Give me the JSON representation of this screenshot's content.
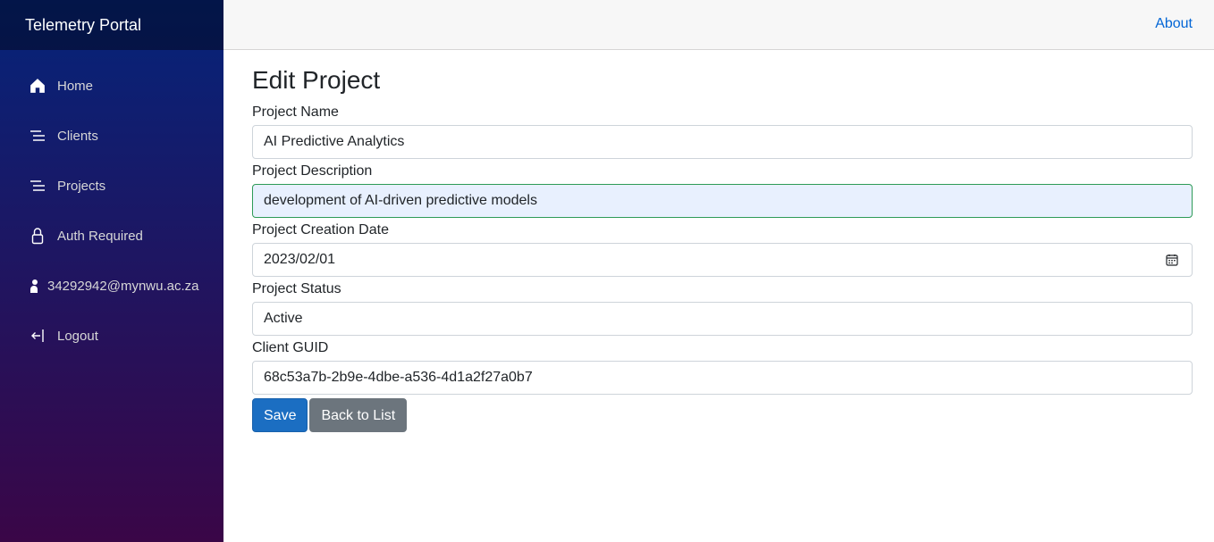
{
  "sidebar": {
    "brand": "Telemetry Portal",
    "items": [
      {
        "label": "Home",
        "icon": "home-icon"
      },
      {
        "label": "Clients",
        "icon": "list-icon"
      },
      {
        "label": "Projects",
        "icon": "list-icon"
      },
      {
        "label": "Auth Required",
        "icon": "lock-icon"
      },
      {
        "label": "34292942@mynwu.ac.za",
        "icon": "user-icon"
      },
      {
        "label": "Logout",
        "icon": "logout-icon"
      }
    ]
  },
  "topbar": {
    "about": "About"
  },
  "form": {
    "title": "Edit Project",
    "fields": {
      "name": {
        "label": "Project Name",
        "value": "AI Predictive Analytics"
      },
      "description": {
        "label": "Project Description",
        "value": "development of AI-driven predictive models"
      },
      "date": {
        "label": "Project Creation Date",
        "value": "2023/02/01"
      },
      "status": {
        "label": "Project Status",
        "value": "Active"
      },
      "client": {
        "label": "Client GUID",
        "value": "68c53a7b-2b9e-4dbe-a536-4d1a2f27a0b7"
      }
    },
    "save_label": "Save",
    "back_label": "Back to List"
  },
  "colors": {
    "primary": "#1b6ec2",
    "secondary": "#6c757d",
    "link": "#0366d6",
    "sidebar_top": "#05247a",
    "sidebar_bottom": "#3a0647"
  }
}
